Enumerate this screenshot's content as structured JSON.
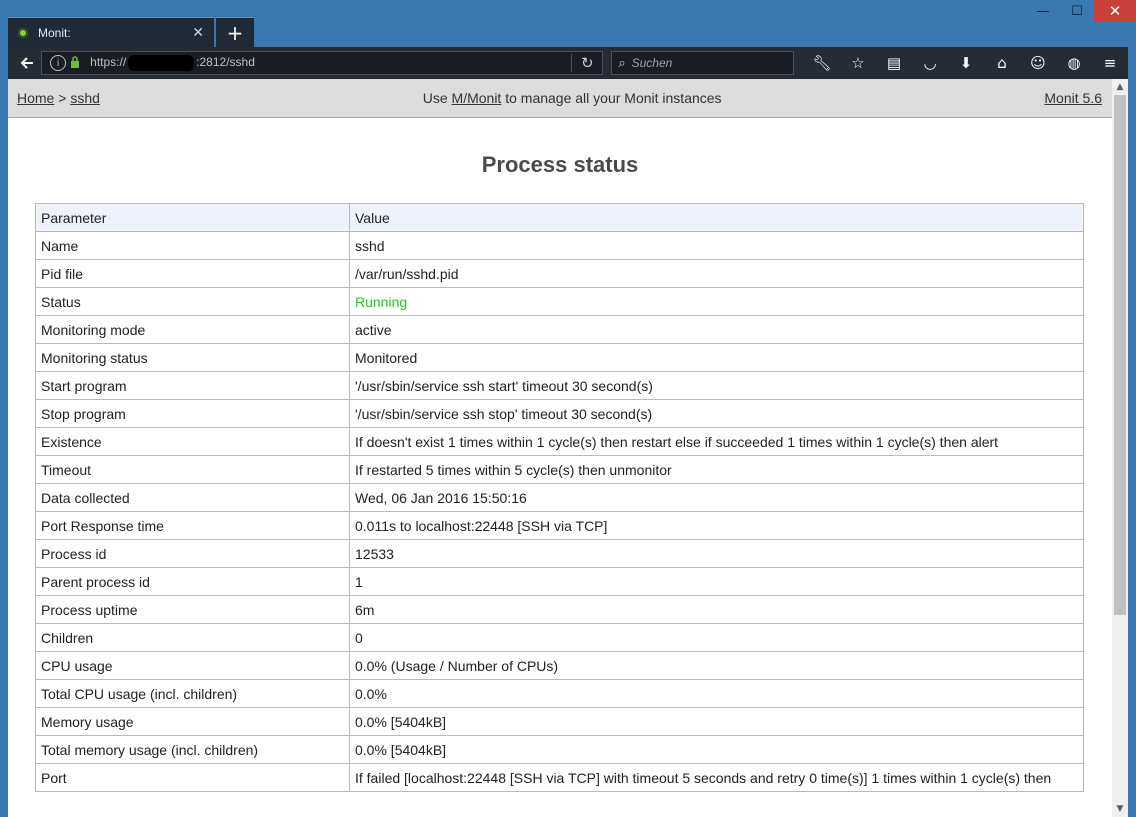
{
  "window": {
    "min": "—",
    "max": "☐",
    "close": "✕"
  },
  "tab": {
    "title": "Monit:",
    "close": "✕",
    "new_tab": "+"
  },
  "nav": {
    "back": "🡐",
    "url_prefix": "https://",
    "url_suffix": ":2812/sshd",
    "search_placeholder": "Suchen"
  },
  "header": {
    "home": "Home",
    "sep": ">",
    "current": "sshd",
    "use_text": "Use",
    "mmonit": "M/Monit",
    "manage_text": "to manage all your Monit instances",
    "version": "Monit 5.6"
  },
  "title": "Process status",
  "table": {
    "header": [
      "Parameter",
      "Value"
    ],
    "rows": [
      [
        "Name",
        "sshd"
      ],
      [
        "Pid file",
        "/var/run/sshd.pid"
      ],
      [
        "Status",
        "Running"
      ],
      [
        "Monitoring mode",
        "active"
      ],
      [
        "Monitoring status",
        "Monitored"
      ],
      [
        "Start program",
        "'/usr/sbin/service ssh start' timeout 30 second(s)"
      ],
      [
        "Stop program",
        "'/usr/sbin/service ssh stop' timeout 30 second(s)"
      ],
      [
        "Existence",
        "If doesn't exist 1 times within 1 cycle(s) then restart else if succeeded 1 times within 1 cycle(s) then alert"
      ],
      [
        "Timeout",
        "If restarted 5 times within 5 cycle(s) then unmonitor"
      ],
      [
        "Data collected",
        "Wed, 06 Jan 2016 15:50:16"
      ],
      [
        "Port Response time",
        "0.011s to localhost:22448 [SSH via TCP]"
      ],
      [
        "Process id",
        "12533"
      ],
      [
        "Parent process id",
        "1"
      ],
      [
        "Process uptime",
        "6m"
      ],
      [
        "Children",
        "0"
      ],
      [
        "CPU usage",
        "0.0%   (Usage / Number of CPUs)"
      ],
      [
        "Total CPU usage (incl. children)",
        "0.0%"
      ],
      [
        "Memory usage",
        "0.0% [5404kB]"
      ],
      [
        "Total memory usage (incl. children)",
        "0.0% [5404kB]"
      ],
      [
        "Port",
        "If failed [localhost:22448 [SSH via TCP] with timeout 5 seconds and retry 0 time(s)] 1 times within 1 cycle(s) then"
      ]
    ]
  },
  "colors": {
    "status_running": "#21c821",
    "table_header_bg": "#edf3fd"
  }
}
